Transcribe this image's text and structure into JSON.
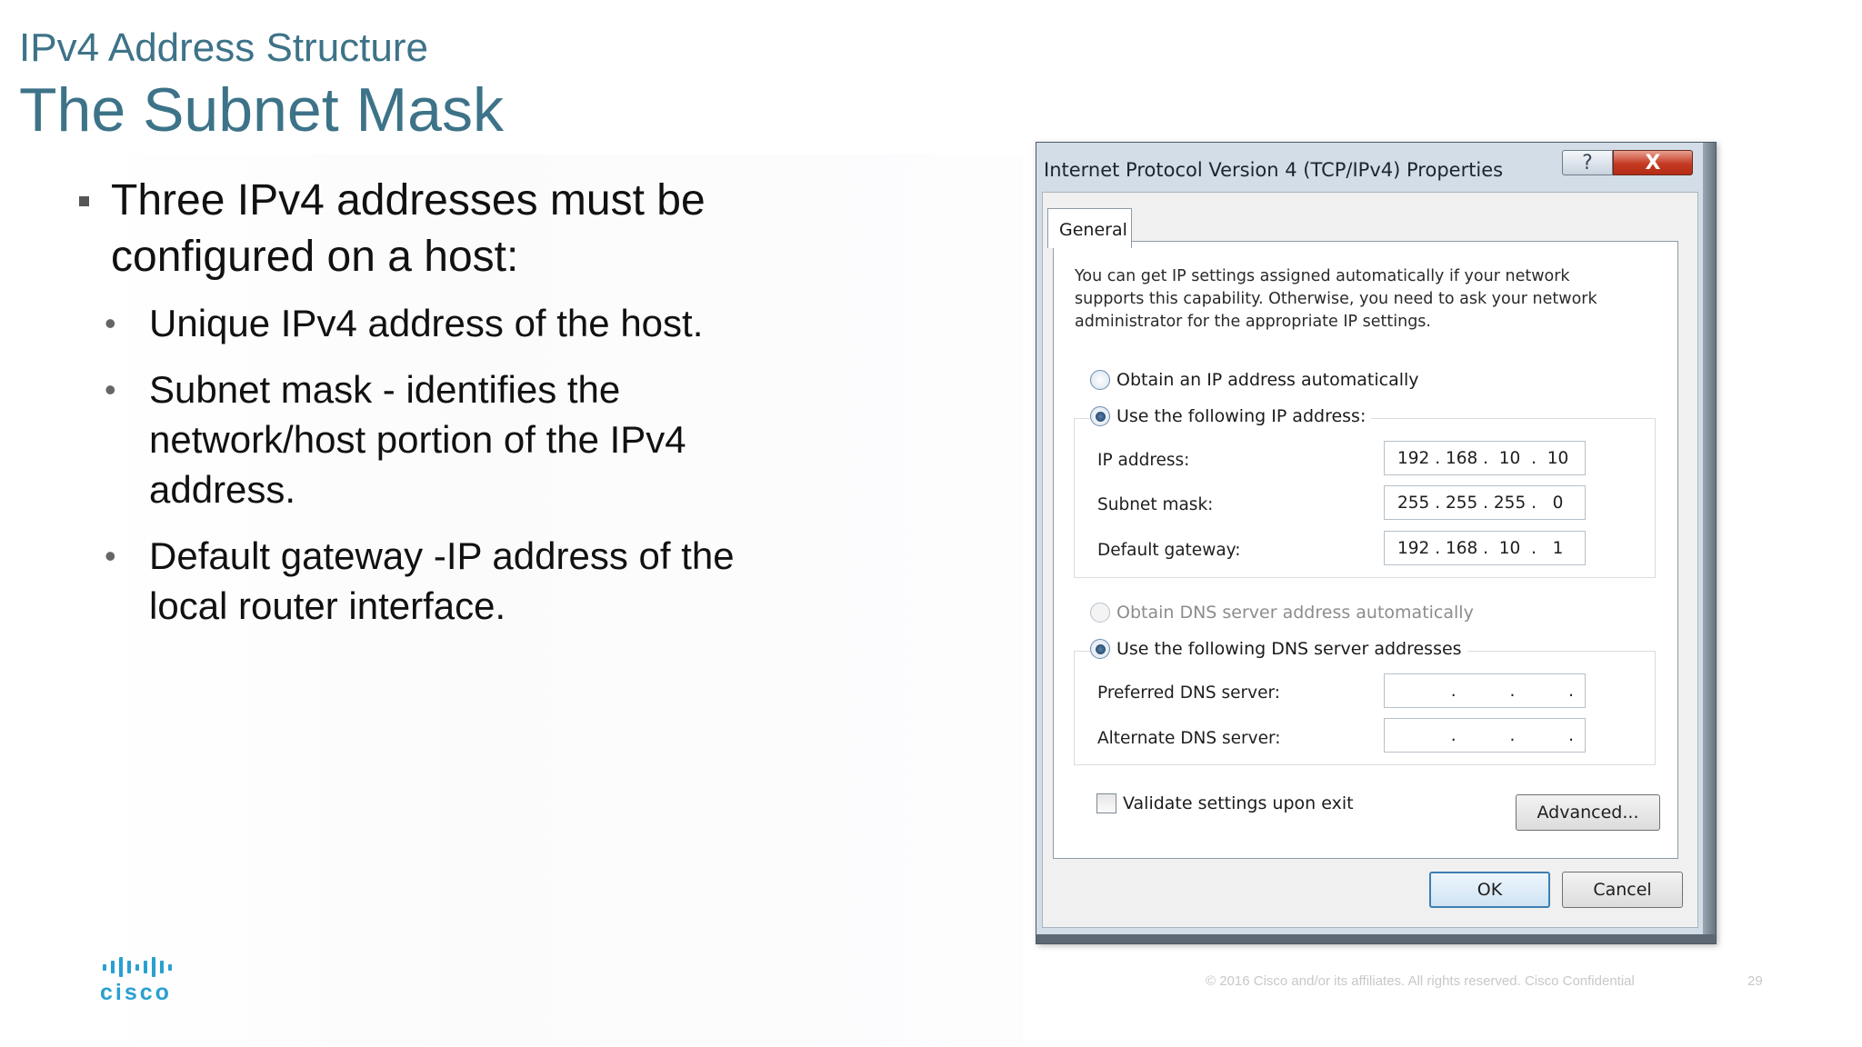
{
  "slide": {
    "subtitle": "IPv4 Address Structure",
    "title": "The Subnet Mask",
    "main_bullet": "Three IPv4 addresses must be configured on a host:",
    "sub_bullets": [
      "Unique IPv4 address of the host.",
      "Subnet mask - identifies the network/host portion of the IPv4 address.",
      "Default gateway -IP address of the local router interface."
    ],
    "logo_text": "cisco",
    "footer": "© 2016  Cisco and/or its affiliates. All rights reserved.   Cisco Confidential",
    "page_number": "29"
  },
  "dialog": {
    "title": "Internet Protocol Version 4 (TCP/IPv4) Properties",
    "help_glyph": "?",
    "close_glyph": "X",
    "tab_label": "General",
    "info_text": "You can get IP settings assigned automatically if your network supports this capability. Otherwise, you need to ask your network administrator for the appropriate IP settings.",
    "ip_radios": {
      "auto_label": "Obtain an IP address automatically",
      "manual_label": "Use the following IP address:",
      "selected": "manual"
    },
    "ip_fields": [
      {
        "label": "IP address:",
        "value": "192 . 168 .  10  .  10"
      },
      {
        "label": "Subnet mask:",
        "value": "255 . 255 . 255 .   0"
      },
      {
        "label": "Default gateway:",
        "value": "192 . 168 .  10  .   1"
      }
    ],
    "dns_radios": {
      "auto_label": "Obtain DNS server address automatically",
      "manual_label": "Use the following DNS server addresses",
      "selected": "manual",
      "auto_enabled": false
    },
    "dns_fields": [
      {
        "label": "Preferred DNS server:",
        "value": "          .          .          ."
      },
      {
        "label": "Alternate DNS server:",
        "value": "          .          .          ."
      }
    ],
    "validate_label": "Validate settings upon exit",
    "validate_checked": false,
    "advanced_label": "Advanced...",
    "ok_label": "OK",
    "cancel_label": "Cancel"
  },
  "colors": {
    "title_teal": "#3d7388",
    "cisco_blue": "#2aa0d0",
    "close_red": "#c43a22"
  }
}
